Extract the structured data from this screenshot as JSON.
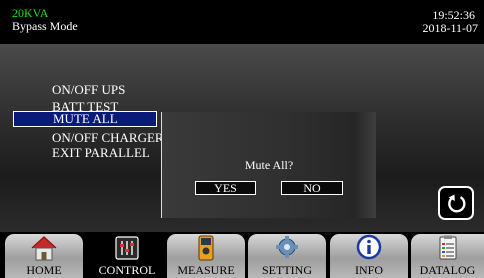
{
  "header": {
    "model": "20KVA",
    "mode": "Bypass Mode",
    "time": "19:52:36",
    "date": "2018-11-07"
  },
  "menu": {
    "items": [
      {
        "label": "ON/OFF UPS"
      },
      {
        "label": "BATT TEST"
      },
      {
        "label": "MUTE ALL"
      },
      {
        "label": "ON/OFF CHARGER"
      },
      {
        "label": "EXIT PARALLEL"
      }
    ],
    "selected_index": 2
  },
  "dialog": {
    "message": "Mute All?",
    "yes_label": "YES",
    "no_label": "NO"
  },
  "tabs": [
    {
      "label": "HOME",
      "icon": "home-icon"
    },
    {
      "label": "CONTROL",
      "icon": "sliders-icon",
      "active": true
    },
    {
      "label": "MEASURE",
      "icon": "multimeter-icon"
    },
    {
      "label": "SETTING",
      "icon": "gear-icon"
    },
    {
      "label": "INFO",
      "icon": "info-icon"
    },
    {
      "label": "DATALOG",
      "icon": "clipboard-icon"
    }
  ],
  "colors": {
    "model_text": "#1ee01e",
    "selected_bg": "#0a1a78",
    "background": "#000000"
  }
}
